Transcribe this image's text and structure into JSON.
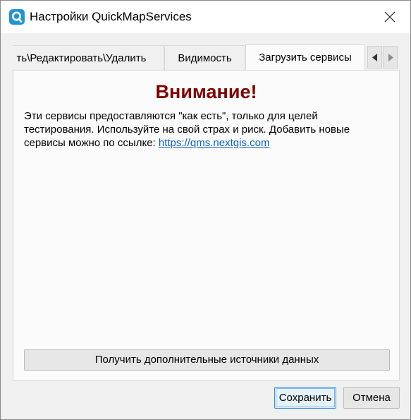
{
  "window": {
    "title": "Настройки QuickMapServices",
    "icon": "quickmapservices-icon",
    "accent_color": "#1f95d6"
  },
  "tabs": [
    {
      "label": "ть\\Редактировать\\Удалить",
      "active": false
    },
    {
      "label": "Видимость",
      "active": false
    },
    {
      "label": "Загрузить сервисы",
      "active": true
    }
  ],
  "tab_scroll": {
    "left_icon": "chevron-left-icon",
    "right_icon": "chevron-right-icon"
  },
  "panel": {
    "warning_title": "Внимание!",
    "warning_color": "#800000",
    "info_text": "Эти сервисы предоставляются \"как есть\", только для целей тестирования. Используйте на свой страх и риск. Добавить новые сервисы можно по ссылке: ",
    "link_text": "https://qms.nextgis.com",
    "link_color": "#0b62c4",
    "more_sources_button": "Получить дополнительные источники данных"
  },
  "footer": {
    "save_label": "Сохранить",
    "cancel_label": "Отмена"
  }
}
